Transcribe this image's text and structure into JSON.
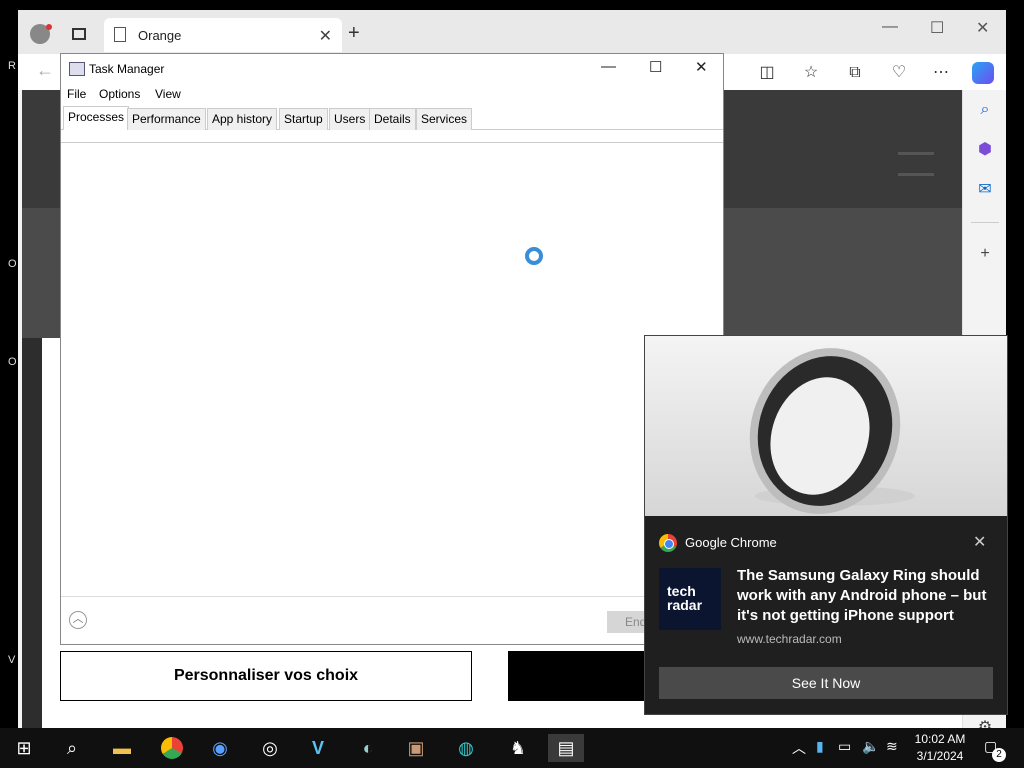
{
  "desktop": {
    "fragments": [
      "R",
      "O",
      "O",
      "V"
    ]
  },
  "browser": {
    "tab_title": "Orange",
    "window_controls": {
      "minimize": "—",
      "maximize": "☐",
      "close": "✕"
    },
    "toolbar_icons": [
      "split-screen-icon",
      "favorites-icon",
      "collections-icon",
      "performance-icon",
      "more-icon",
      "copilot-icon"
    ],
    "sidebar_icons": [
      "search-icon",
      "m365-icon",
      "outlook-icon",
      "add-icon"
    ]
  },
  "cookie_banner": {
    "personalize_label": "Personnaliser vos choix"
  },
  "task_manager": {
    "title": "Task Manager",
    "menu": [
      "File",
      "Options",
      "View"
    ],
    "tabs": [
      "Processes",
      "Performance",
      "App history",
      "Startup",
      "Users",
      "Details",
      "Services"
    ],
    "active_tab": "Processes",
    "end_task_label": "End task"
  },
  "notification": {
    "app_name": "Google Chrome",
    "logo_text_line1": "tech",
    "logo_text_line2": "radar",
    "headline": "The Samsung Galaxy Ring should work with any Android phone – but it's not getting iPhone support",
    "source_url": "www.techradar.com",
    "cta_label": "See It Now"
  },
  "taskbar": {
    "apps": [
      "start-icon",
      "search-icon",
      "file-explorer-icon",
      "chrome-icon",
      "app-icon",
      "obs-icon",
      "app-v-icon",
      "steam-icon",
      "photos-icon",
      "edge-icon",
      "app-icon-2",
      "task-manager-icon"
    ],
    "time": "10:02 AM",
    "date": "3/1/2024",
    "notification_count": "2"
  }
}
